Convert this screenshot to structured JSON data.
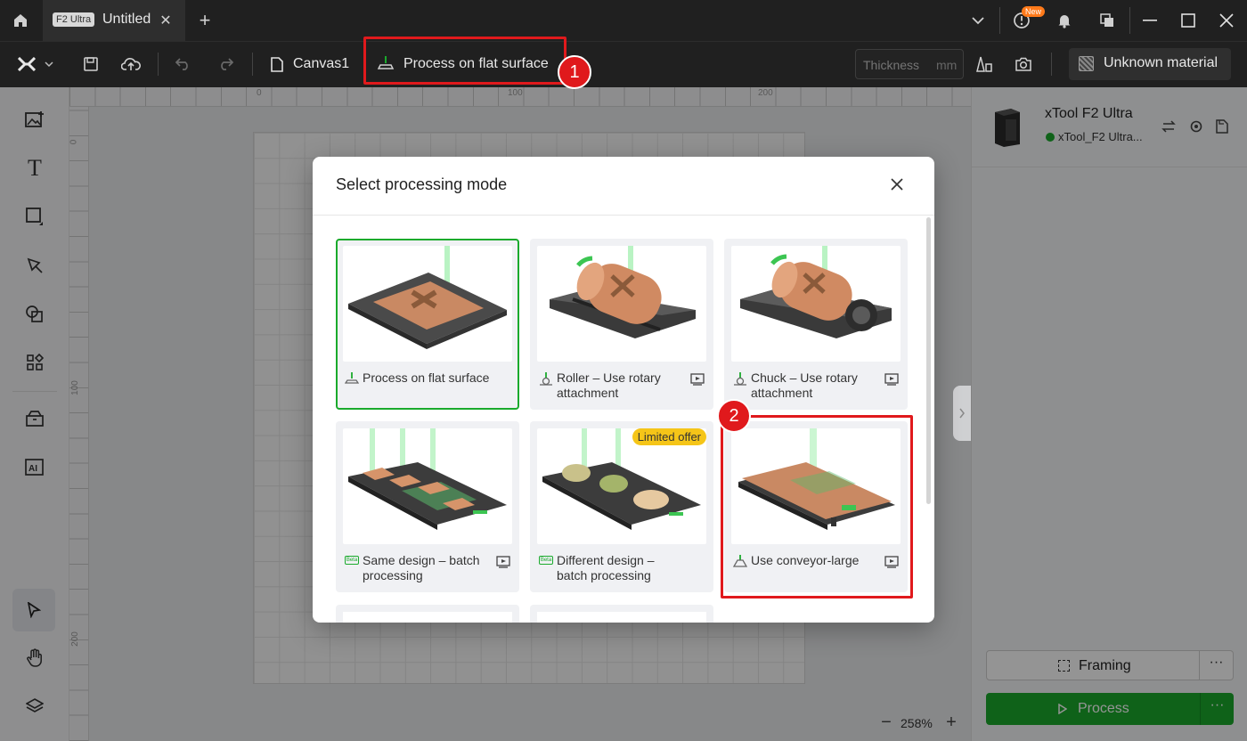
{
  "titlebar": {
    "home_icon": "home-icon",
    "tab_badge": "F2 Ultra",
    "tab_title": "Untitled",
    "new_badge": "New"
  },
  "toolbar": {
    "canvas_name": "Canvas1",
    "mode_label": "Process on flat surface",
    "thickness_placeholder": "Thickness",
    "thickness_unit": "mm",
    "material_label": "Unknown material"
  },
  "ruler": {
    "top_ticks": [
      "0",
      "100",
      "200"
    ],
    "left_ticks": [
      "0",
      "100",
      "200"
    ]
  },
  "device": {
    "name": "xTool F2 Ultra",
    "connection": "xTool_F2 Ultra...",
    "status_color": "#1aaa2c"
  },
  "actions": {
    "framing_label": "Framing",
    "process_label": "Process"
  },
  "zoom": {
    "level": "258%"
  },
  "modal": {
    "title": "Select processing mode",
    "modes": [
      {
        "label": "Process on flat surface",
        "selected": true
      },
      {
        "label": "Roller – Use rotary attachment"
      },
      {
        "label": "Chuck – Use rotary attachment"
      },
      {
        "label": "Same design – batch processing"
      },
      {
        "label": "Different design – batch processing",
        "tag": "Limited offer"
      },
      {
        "label": "Use conveyor-large"
      }
    ]
  },
  "annotations": {
    "step1": "1",
    "step2": "2"
  },
  "colors": {
    "accent_green": "#1aaa2c",
    "highlight_red": "#e0191c",
    "offer_yellow": "#f5c518"
  }
}
